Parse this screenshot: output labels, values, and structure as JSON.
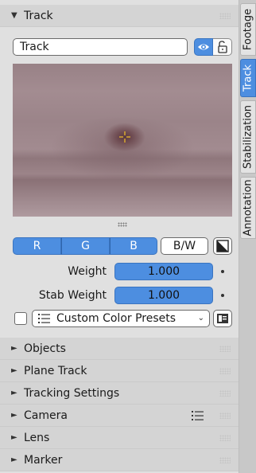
{
  "track_panel": {
    "header": "Track",
    "track_name": "Track",
    "channels": {
      "r": "R",
      "g": "G",
      "b": "B"
    },
    "bw_label": "B/W",
    "weight_label": "Weight",
    "weight_value": "1.000",
    "stab_weight_label": "Stab Weight",
    "stab_weight_value": "1.000",
    "color_presets_label": "Custom Color Presets"
  },
  "collapsed_panels": [
    {
      "label": "Objects"
    },
    {
      "label": "Plane Track"
    },
    {
      "label": "Tracking Settings"
    },
    {
      "label": "Camera"
    },
    {
      "label": "Lens"
    },
    {
      "label": "Marker"
    }
  ],
  "side_tabs": [
    {
      "label": "Footage",
      "active": false
    },
    {
      "label": "Track",
      "active": true
    },
    {
      "label": "Stabilization",
      "active": false
    },
    {
      "label": "Annotation",
      "active": false
    }
  ],
  "colors": {
    "accent": "#4d8ee0",
    "panel_bg": "#e0e0e0",
    "header_bg": "#d4d4d4"
  },
  "icons": [
    "eye-icon",
    "lock-icon",
    "invert-icon",
    "list-icon",
    "preset-icon",
    "crosshair-icon"
  ]
}
